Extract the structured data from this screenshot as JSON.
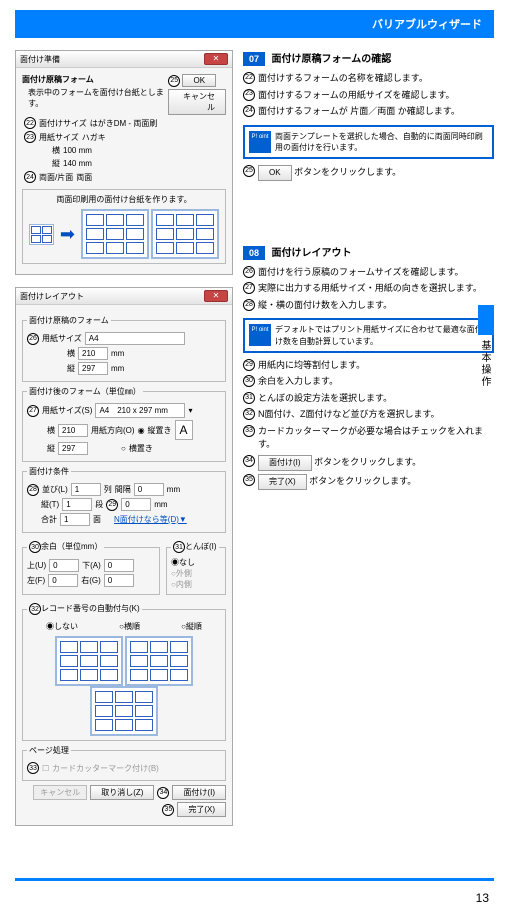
{
  "header": "バリアブルウィザード",
  "page_number": "13",
  "side_label": "基本操作",
  "win1": {
    "title": "面付け準備",
    "subtitle": "面付け原稿フォーム",
    "desc": "表示中のフォームを面付け台紙とします。",
    "size_label": "面付けサイズ",
    "size_value": "はがきDM - 両面刷",
    "paper_label": "用紙サイズ",
    "paper_value": "ハガキ",
    "w_label": "横",
    "w_value": "100 mm",
    "h_label": "縦",
    "h_value": "140 mm",
    "dual_label": "両面/片面",
    "dual_value": "両面",
    "mid_text": "両面印刷用の面付け台紙を作ります。",
    "ok": "OK",
    "cancel": "キャンセル"
  },
  "win2": {
    "title": "面付けレイアウト",
    "sec1_title": "面付け原稿のフォーム",
    "sec1_size_label": "用紙サイズ",
    "sec1_size_value": "A4",
    "sec1_w_label": "横",
    "sec1_w_value": "210",
    "mm": "mm",
    "sec1_h_label": "縦",
    "sec1_h_value": "297",
    "sec2_title": "面付け後のフォーム（単位㎜）",
    "sec2_size_label": "用紙サイズ(S)",
    "sec2_size_value": "A4　210 x 297 mm",
    "sec2_w_label": "横",
    "sec2_w_value": "210",
    "sec2_dir_label": "用紙方向(O)",
    "sec2_port": "縦置き",
    "sec2_land": "横置き",
    "sec3_title": "面付け条件",
    "proc_label": "並び(L)",
    "proc_value": "1",
    "sort_label": "列",
    "gap_label": "間隔",
    "gap_val": "0",
    "h2": "縦(T)",
    "h2v": "1",
    "dan": "段",
    "gap2v": "0",
    "sum_label": "合計",
    "sum_val": "1",
    "men": "面",
    "eq_link": "N面付けなら等(D)▼",
    "sec4_title": "余白（単位mm）",
    "top": "上(U)",
    "top_v": "0",
    "bottom": "下(A)",
    "bottom_v": "0",
    "left": "左(F)",
    "left_v": "0",
    "right": "右(G)",
    "right_v": "0",
    "sec5_title": "とんぼ(I)",
    "t_none": "なし",
    "t_ext": "外側",
    "t_int": "内側",
    "sec6_title": "レコード番号の自動付与(K)",
    "r_none": "しない",
    "r_h": "横順",
    "r_v": "縦順",
    "sec7_title": "ページ処理",
    "card_chk": "カードカッターマーク付け(B)",
    "cancel_btn": "キャンセル",
    "back_btn": "取り消し(Z)",
    "do_btn": "面付け(I)",
    "done_btn": "完了(X)"
  },
  "step07": {
    "badge": "07",
    "title": "面付け原稿フォームの確認",
    "i22": "面付けするフォームの名称を確認します。",
    "i23": "面付けするフォームの用紙サイズを確認します。",
    "i24": "面付けするフォームが 片面／両面 か確認します。",
    "point": "両面テンプレートを選択した場合、自動的に両面同時印刷用の面付けを行います。",
    "i25a": "OK",
    "i25b": " ボタンをクリックします。"
  },
  "step08": {
    "badge": "08",
    "title": "面付けレイアウト",
    "i26": "面付けを行う原稿のフォームサイズを確認します。",
    "i27": "実際に出力する用紙サイズ・用紙の向きを選択します。",
    "i28": "縦・横の面付け数を入力します。",
    "point": "デフォルトではプリント用紙サイズに合わせて最適な面付け数を自動計算しています。",
    "i29": "用紙内に均等割付します。",
    "i30": "余白を入力します。",
    "i31": "とんぼの設定方法を選択します。",
    "i32": "N面付け、Z面付けなど並び方を選択します。",
    "i33": "カードカッターマークが必要な場合はチェックを入れます。",
    "i34a": "面付け(I)",
    "i34b": " ボタンをクリックします。",
    "i35a": "完了(X)",
    "i35b": " ボタンをクリックします。"
  },
  "point_label": "P!\noint"
}
